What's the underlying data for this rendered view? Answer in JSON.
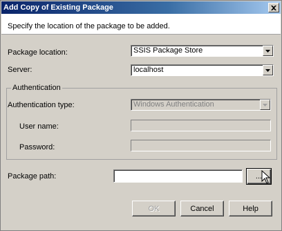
{
  "window": {
    "title": "Add Copy of Existing Package",
    "close_icon": "close-icon"
  },
  "description": "Specify the location of the package to be added.",
  "package_location": {
    "label": "Package location:",
    "value": "SSIS Package Store"
  },
  "server": {
    "label": "Server:",
    "value": "localhost"
  },
  "authentication": {
    "group_label": "Authentication",
    "type_label": "Authentication type:",
    "type_value": "Windows Authentication",
    "username_label": "User name:",
    "username_value": "",
    "password_label": "Password:",
    "password_value": ""
  },
  "package_path": {
    "label": "Package path:",
    "value": "",
    "browse_label": "..."
  },
  "buttons": {
    "ok": "OK",
    "cancel": "Cancel",
    "help": "Help"
  }
}
